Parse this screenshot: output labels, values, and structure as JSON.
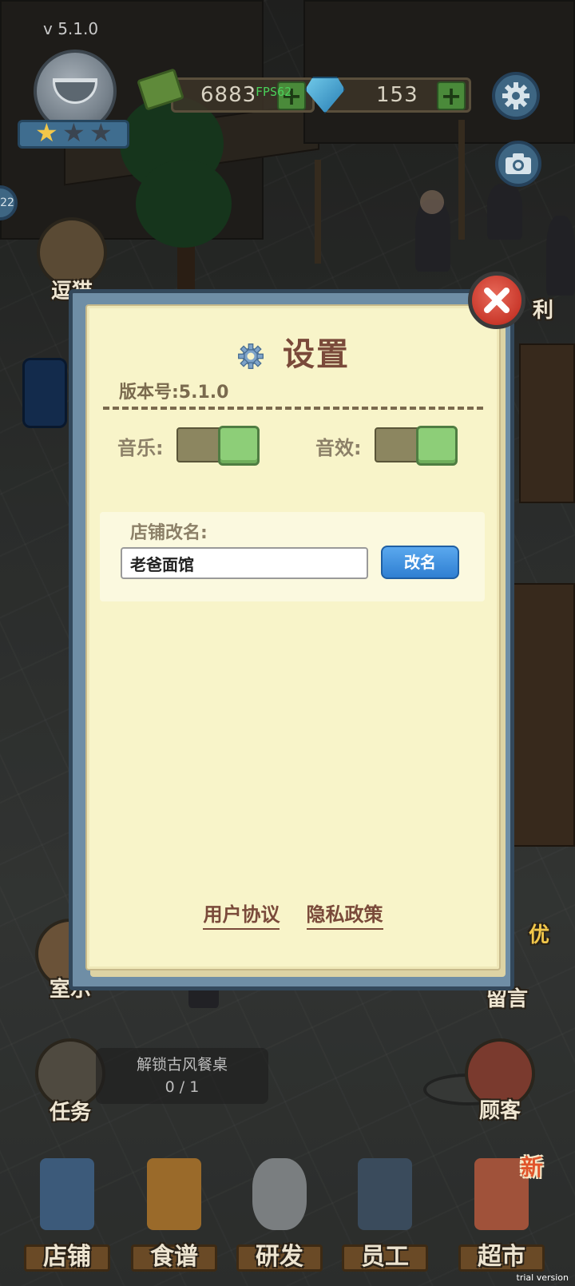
{
  "hud": {
    "version": "v 5.1.0",
    "money": "6883",
    "gems": "153",
    "fps": "FPS62",
    "side_level": "22"
  },
  "side_buttons": {
    "cat": "逗猫",
    "room": "室示",
    "bonus": "利",
    "message": "留言",
    "task": "任务",
    "customer": "顾客",
    "promo": "优"
  },
  "task": {
    "title": "解锁古风餐桌",
    "progress": "0 / 1"
  },
  "bottom_nav": [
    {
      "label": "店铺"
    },
    {
      "label": "食谱"
    },
    {
      "label": "研发"
    },
    {
      "label": "员工"
    },
    {
      "label": "超市",
      "tag": "新"
    }
  ],
  "settings": {
    "title": "设置",
    "version_label": "版本号:5.1.0",
    "music_label": "音乐:",
    "sfx_label": "音效:",
    "music_on": true,
    "sfx_on": true,
    "rename_label": "店铺改名:",
    "shop_name": "老爸面馆",
    "rename_button": "改名",
    "user_agreement": "用户协议",
    "privacy_policy": "隐私政策"
  },
  "watermark": "trial version",
  "colors": {
    "dialog_frame": "#6f8ea6",
    "paper": "#f8f4c9",
    "title": "#7a4a3a",
    "toggle_on": "#8dce78",
    "rename_button": "#3a8ee0",
    "close_button": "#c9382b"
  },
  "icons": [
    "gear-icon",
    "close-icon",
    "camera-icon",
    "settings-gear-icon",
    "plus-icon",
    "money-icon",
    "gem-icon",
    "pencil-icon"
  ]
}
